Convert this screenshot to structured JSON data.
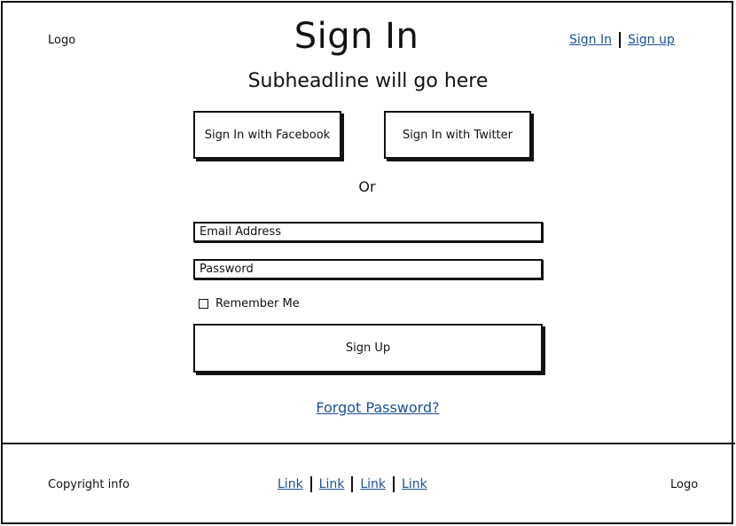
{
  "header": {
    "logo": "Logo",
    "title": "Sign In",
    "nav": [
      "Sign In",
      "Sign up"
    ]
  },
  "subheadline": "Subheadline will go here",
  "social": {
    "facebook": "Sign In with Facebook",
    "twitter": "Sign In with Twitter"
  },
  "or_label": "Or",
  "form": {
    "email_placeholder": "Email Address",
    "password_placeholder": "Password",
    "remember_label": "Remember Me",
    "remember_checked": false,
    "submit_label": "Sign Up"
  },
  "forgot_link": "Forgot Password?",
  "footer": {
    "copyright": "Copyright info",
    "links": [
      "Link",
      "Link",
      "Link",
      "Link"
    ],
    "logo": "Logo"
  },
  "colors": {
    "link": "#1d4e9a",
    "border": "#111111",
    "background": "#ffffff"
  }
}
